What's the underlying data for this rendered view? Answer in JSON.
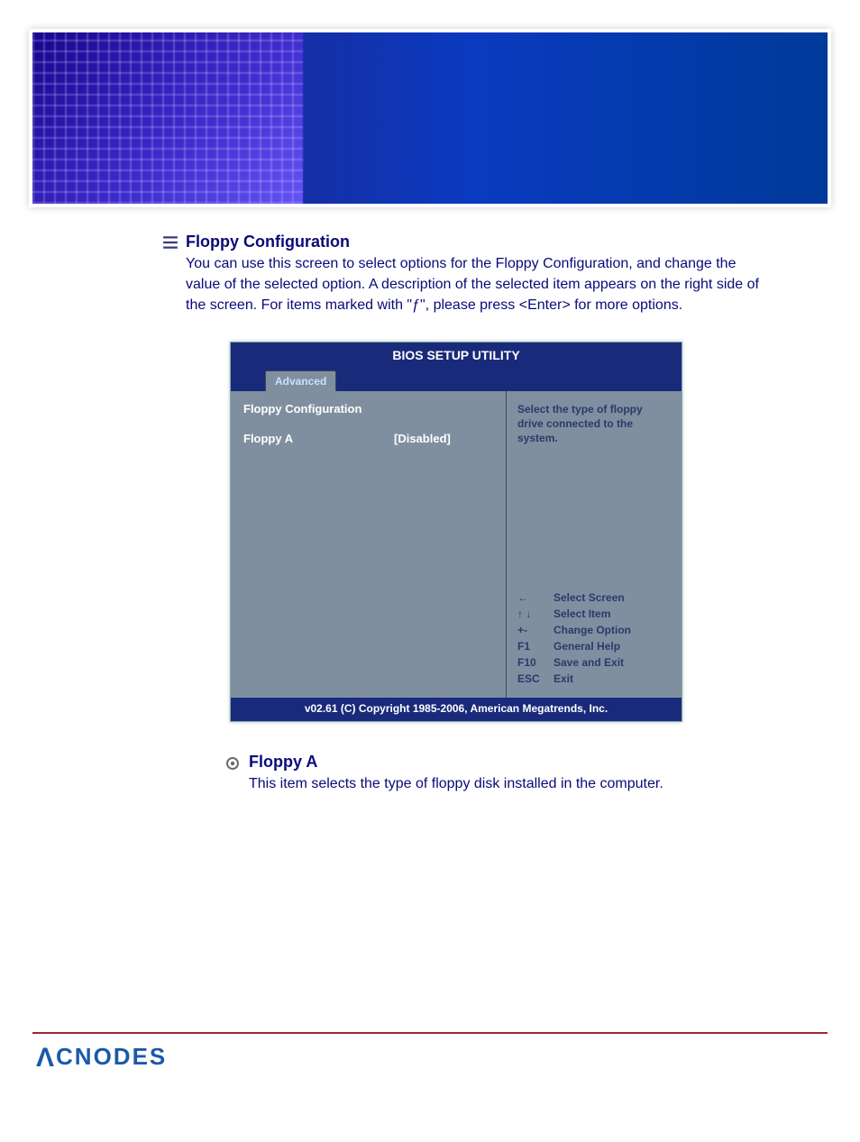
{
  "section1": {
    "title": "Floppy Configuration",
    "desc": "You can use this screen to select options for the Floppy Configuration, and change the value of the selected option. A description of the selected item appears on the right side of the screen. For items marked with \"ƒ\", please press <Enter> for more options."
  },
  "bios": {
    "title": "BIOS SETUP UTILITY",
    "tab": "Advanced",
    "heading": "Floppy Configuration",
    "item_label": "Floppy A",
    "item_value": "[Disabled]",
    "help": "Select the type of floppy drive connected to the system.",
    "keys": [
      {
        "k": "←",
        "d": "Select Screen"
      },
      {
        "k": "↑ ↓",
        "d": "Select Item"
      },
      {
        "k": "+-",
        "d": "Change Option"
      },
      {
        "k": "F1",
        "d": "General Help"
      },
      {
        "k": "F10",
        "d": "Save and Exit"
      },
      {
        "k": "ESC",
        "d": "Exit"
      }
    ],
    "footer": "v02.61 (C) Copyright 1985-2006, American Megatrends, Inc."
  },
  "section2": {
    "title": "Floppy A",
    "desc": "This item selects the type of floppy disk installed in the computer."
  },
  "brand": "CNODES"
}
